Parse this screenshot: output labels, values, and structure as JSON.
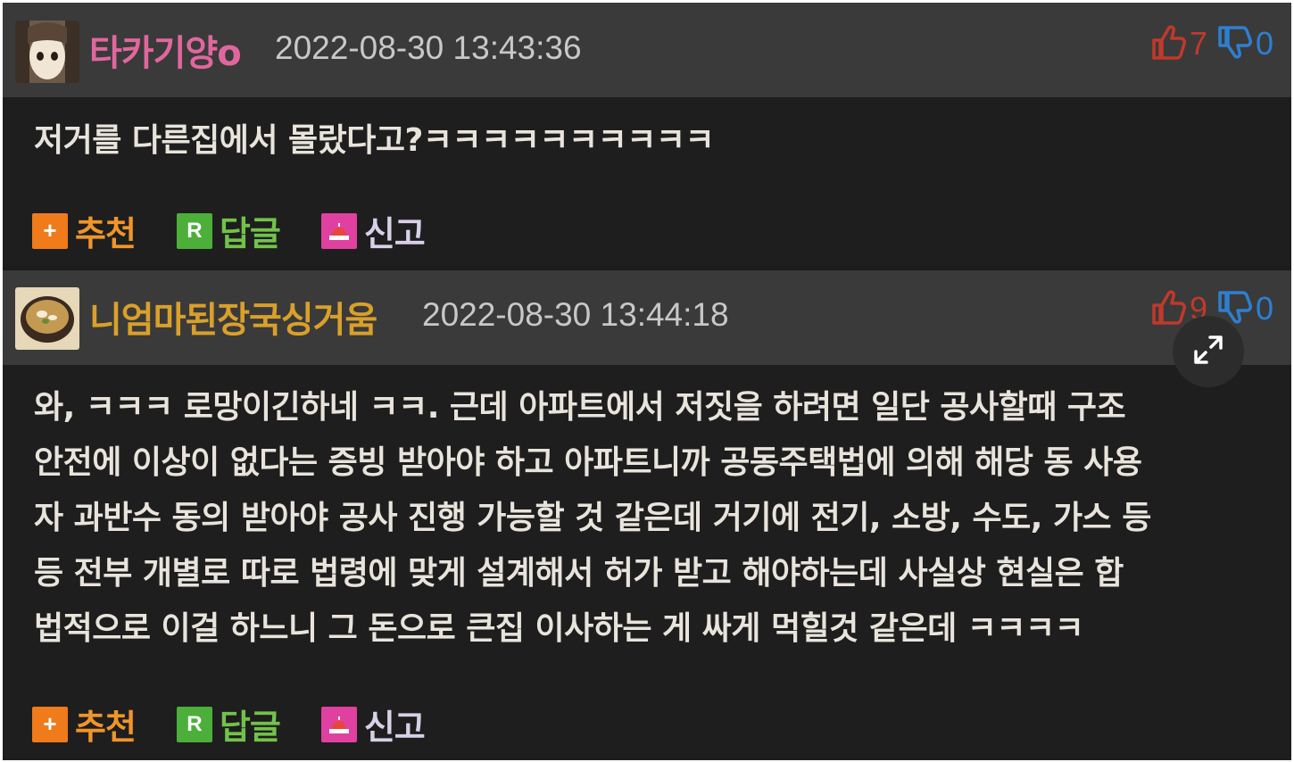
{
  "comments": [
    {
      "nickname": "타카기양o",
      "nickname_color": "#e0679e",
      "avatar_icon": "anime-character-avatar-icon",
      "datetime": "2022-08-30 13:43:36",
      "upvotes": "7",
      "downvotes": "0",
      "text_lines": [
        "저거를 다른집에서 몰랐다고?ㅋㅋㅋㅋㅋㅋㅋㅋㅋㅋ"
      ]
    },
    {
      "nickname": "니엄마된장국싱거움",
      "nickname_color": "#d9a02a",
      "avatar_icon": "soup-bowl-avatar-icon",
      "datetime": "2022-08-30 13:44:18",
      "upvotes": "9",
      "downvotes": "0",
      "text_lines": [
        "와, ㅋㅋㅋ 로망이긴하네 ㅋㅋ. 근데 아파트에서 저짓을 하려면 일단 공사할때 구조",
        "안전에 이상이 없다는 증빙 받아야 하고 아파트니까 공동주택법에 의해 해당 동 사용",
        "자 과반수 동의 받아야 공사 진행 가능할 것 같은데 거기에 전기, 소방, 수도, 가스 등",
        "등 전부 개별로 따로 법령에 맞게 설계해서 허가 받고 해야하는데 사실상 현실은 합",
        "법적으로 이걸 하느니 그 돈으로 큰집 이사하는 게 싸게 먹힐것 같은데 ㅋㅋㅋㅋ"
      ]
    }
  ],
  "actions": {
    "recommend_label": "추천",
    "recommend_icon_glyph": "+",
    "reply_label": "답글",
    "reply_icon_glyph": "R",
    "report_label": "신고"
  },
  "icons": {
    "thumb_up": "thumbs-up-icon",
    "thumb_down": "thumbs-down-icon",
    "expand": "expand-icon",
    "report": "siren-icon"
  },
  "colors": {
    "header_bg": "#3a3a3a",
    "body_bg": "#1e1e1e",
    "upvote": "#c0392b",
    "downvote": "#2e7fd0"
  }
}
